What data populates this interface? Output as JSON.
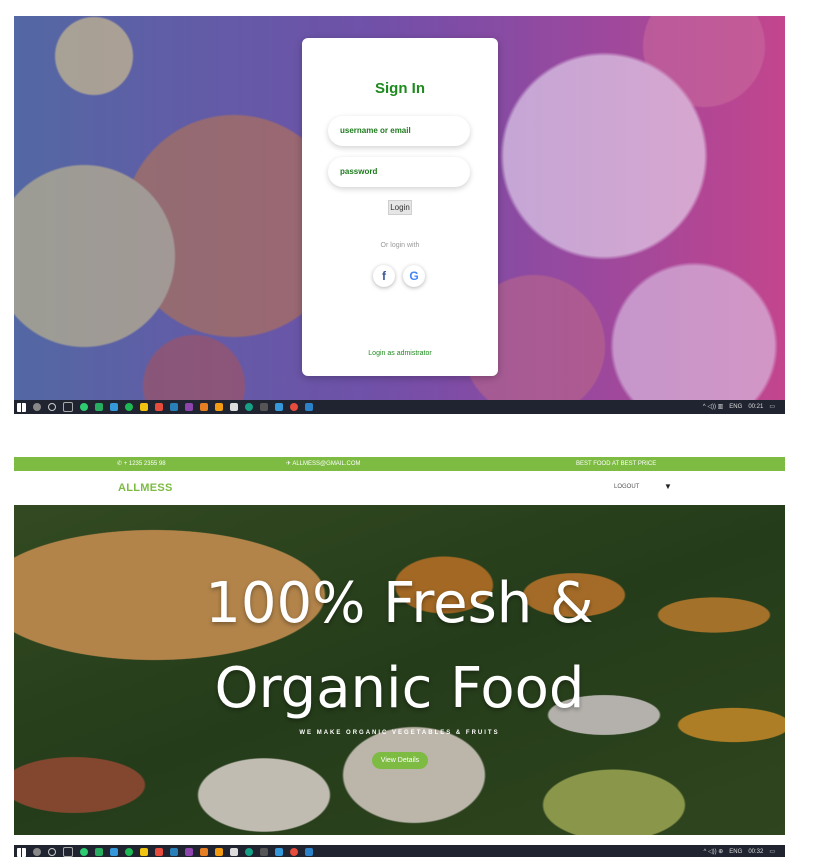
{
  "signin": {
    "title": "Sign In",
    "username_placeholder": "username or email",
    "password_placeholder": "password",
    "login_label": "Login",
    "or_login_with": "Or login with",
    "facebook_glyph": "f",
    "google_glyph": "G",
    "admin_link": "Login as admistrator"
  },
  "taskbar1": {
    "lang": "ENG",
    "time": "00:21"
  },
  "site": {
    "phone": "+ 1235 2355 98",
    "email": "ALLMESS@GMAIL.COM",
    "tagline": "BEST FOOD AT BEST PRICE",
    "logo": "ALLMESS",
    "logout": "LOGOUT",
    "hero_line1": "100% Fresh &",
    "hero_line2": "Organic Food",
    "hero_sub": "WE MAKE ORGANIC VEGETABLES & FRUITS",
    "view_details": "View Details"
  },
  "taskbar2": {
    "lang": "ENG",
    "time": "00:32"
  },
  "colors": {
    "brand_green": "#7dbb43",
    "signin_green": "#1e8a1e",
    "taskbar": "#1f2430"
  }
}
